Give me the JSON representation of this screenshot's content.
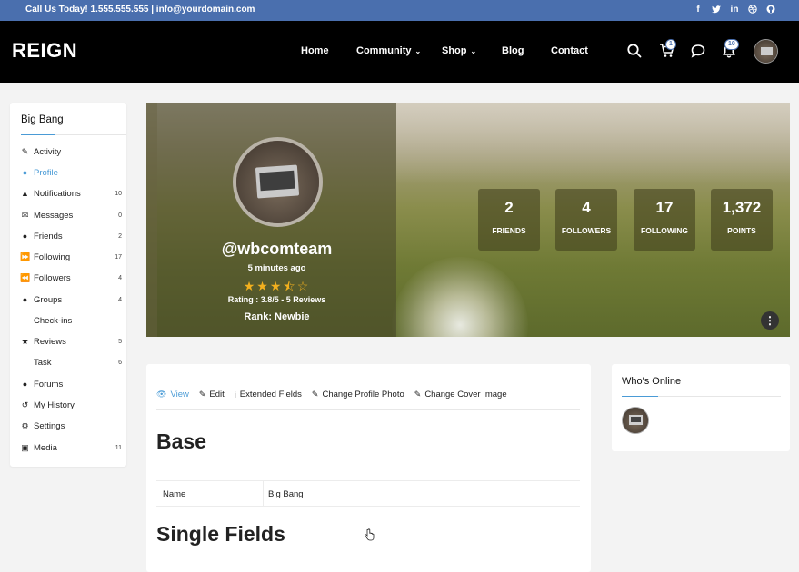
{
  "topbar": {
    "contact": "Call Us Today! 1.555.555.555 | info@yourdomain.com",
    "socials": [
      "facebook-icon",
      "twitter-icon",
      "linkedin-icon",
      "dribbble-icon",
      "github-icon"
    ]
  },
  "header": {
    "logo": "REIGN",
    "nav": [
      {
        "label": "Home"
      },
      {
        "label": "Community"
      },
      {
        "label": "Shop"
      },
      {
        "label": "Blog"
      },
      {
        "label": "Contact"
      }
    ],
    "cart_count": "1",
    "notification_count": "10"
  },
  "sidebar": {
    "title": "Big Bang",
    "items": [
      {
        "label": "Activity",
        "icon": "pencil-icon",
        "count": ""
      },
      {
        "label": "Profile",
        "icon": "user-icon",
        "count": ""
      },
      {
        "label": "Notifications",
        "icon": "bell-icon",
        "count": "10"
      },
      {
        "label": "Messages",
        "icon": "envelope-icon",
        "count": "0"
      },
      {
        "label": "Friends",
        "icon": "user-plus-icon",
        "count": "2"
      },
      {
        "label": "Following",
        "icon": "forward-icon",
        "count": "17"
      },
      {
        "label": "Followers",
        "icon": "backward-icon",
        "count": "4"
      },
      {
        "label": "Groups",
        "icon": "users-icon",
        "count": "4"
      },
      {
        "label": "Check-ins",
        "icon": "info-icon",
        "count": ""
      },
      {
        "label": "Reviews",
        "icon": "star-icon",
        "count": "5"
      },
      {
        "label": "Task",
        "icon": "info-icon",
        "count": "6"
      },
      {
        "label": "Forums",
        "icon": "comments-icon",
        "count": ""
      },
      {
        "label": "My History",
        "icon": "history-icon",
        "count": ""
      },
      {
        "label": "Settings",
        "icon": "gear-icon",
        "count": ""
      },
      {
        "label": "Media",
        "icon": "image-icon",
        "count": "11"
      }
    ]
  },
  "profile": {
    "username": "@wbcomteam",
    "last_active": "5 minutes ago",
    "rating_value": 3.8,
    "rating_text": "Rating : 3.8/5 - 5 Reviews",
    "rank": "Rank: Newbie",
    "stats": [
      {
        "num": "2",
        "label": "FRIENDS"
      },
      {
        "num": "4",
        "label": "FOLLOWERS"
      },
      {
        "num": "17",
        "label": "FOLLOWING"
      },
      {
        "num": "1,372",
        "label": "POINTS"
      }
    ]
  },
  "main": {
    "tabs": [
      {
        "label": "View",
        "icon": "eye-icon"
      },
      {
        "label": "Edit",
        "icon": "edit-icon"
      },
      {
        "label": "Extended Fields",
        "icon": "info-icon"
      },
      {
        "label": "Change Profile Photo",
        "icon": "edit-icon"
      },
      {
        "label": "Change Cover Image",
        "icon": "edit-icon"
      }
    ],
    "section_base": "Base",
    "field_name_key": "Name",
    "field_name_value": "Big Bang",
    "section_single": "Single Fields"
  },
  "online": {
    "title": "Who's Online"
  },
  "colors": {
    "topbar": "#4a6fae",
    "header": "#000000",
    "accent": "#4a9bd6",
    "star": "#f2b01e"
  }
}
